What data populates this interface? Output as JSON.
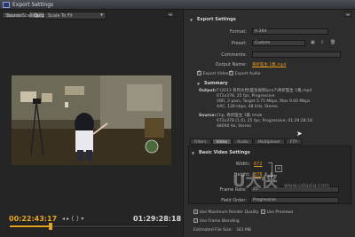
{
  "window": {
    "title": "Export Settings"
  },
  "left": {
    "tabs": [
      {
        "label": "Source"
      },
      {
        "label": "Output"
      }
    ],
    "source_scaling_label": "Source Scaling:",
    "source_scaling_value": "Scale To Fit",
    "current_time": "00:22:43:17",
    "duration": "01:29:28:18",
    "playhead_fraction": 0.25
  },
  "right": {
    "export_settings": {
      "header": "Export Settings",
      "format_label": "Format:",
      "format_value": "H.264",
      "preset_label": "Preset:",
      "preset_value": "Custom",
      "comments_label": "Comments:",
      "output_name_label": "Output Name:",
      "output_name_value": "骨折医生 1集.mp4",
      "export_video_label": "Export Video",
      "export_audio_label": "Export Audio"
    },
    "summary": {
      "header": "Summary",
      "output_label": "Output:",
      "output_lines": [
        "F:\\2013 系列文档\\医生视频\\pro7\\骨折医生 1集.mp4",
        "672x378, 25 fps, Progressive",
        "VBR, 2 pass, Target 5.75 Mbps, Max 9.00 Mbps",
        "AAC, 128 kbps, 48 kHz, Stereo"
      ],
      "source_label": "Source:",
      "source_lines": [
        "Clip, 骨折医生 1集.rmvb",
        "672x378 (1.0), 25 fps, Progressive, 01:29:28:18",
        "48000 Hz, Stereo"
      ]
    },
    "tabs": [
      {
        "label": "Filters"
      },
      {
        "label": "Video"
      },
      {
        "label": "Audio"
      },
      {
        "label": "Multiplexer"
      },
      {
        "label": "FTP"
      }
    ],
    "basic_video": {
      "header": "Basic Video Settings",
      "width_label": "Width:",
      "width_value": "672",
      "height_label": "Height:",
      "height_value": "378",
      "frame_rate_label": "Frame Rate:",
      "frame_rate_value": "25",
      "field_order_label": "Field Order:",
      "field_order_value": "Progressive"
    },
    "max_render_label": "Use Maximum Render Quality",
    "use_previews_label": "Use Previews",
    "frame_blending_label": "Use Frame Blending",
    "file_size_label": "Estimated File Size:",
    "file_size_value": "343 MB"
  },
  "watermark": {
    "text1": "U大侠",
    "text2": "www.udaxia.com"
  },
  "colors": {
    "accent": "#e69a20",
    "panel": "#2d2d2d"
  }
}
